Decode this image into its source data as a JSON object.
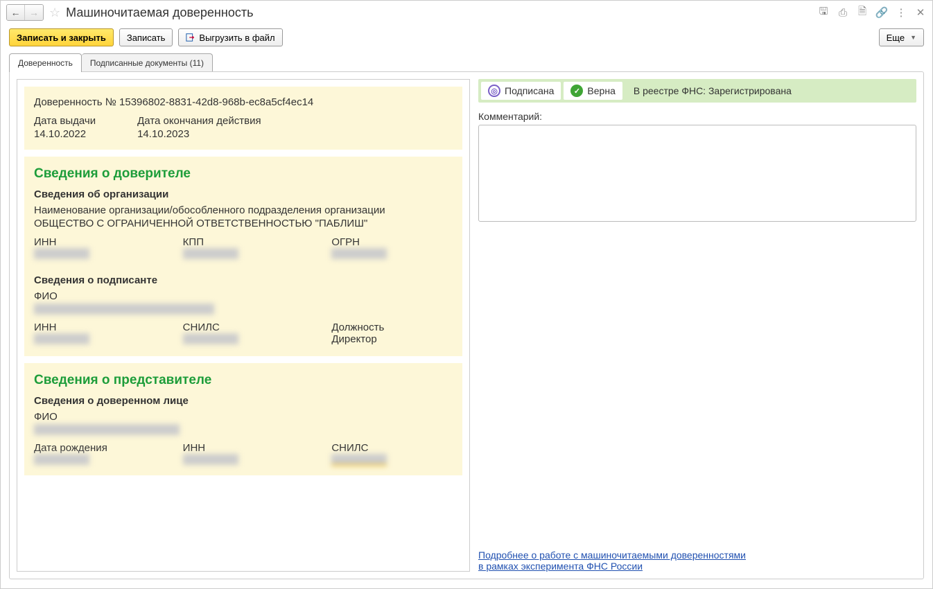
{
  "window": {
    "title": "Машиночитаемая доверенность"
  },
  "toolbar": {
    "save_close": "Записать и закрыть",
    "save": "Записать",
    "export": "Выгрузить в файл",
    "more": "Еще"
  },
  "tabs": {
    "main": "Доверенность",
    "signed": "Подписанные документы (11)"
  },
  "document": {
    "number_line": "Доверенность № 15396802-8831-42d8-968b-ec8a5cf4ec14",
    "issue_date_label": "Дата выдачи",
    "issue_date": "14.10.2022",
    "end_date_label": "Дата окончания действия",
    "end_date": "14.10.2023"
  },
  "principal": {
    "title": "Сведения о доверителе",
    "org_sub": "Сведения об организации",
    "org_name_label": "Наименование организации/обособленного подразделения организации",
    "org_name": "ОБЩЕСТВО С ОГРАНИЧЕННОЙ ОТВЕТСТВЕННОСТЬЮ \"ПАБЛИШ\"",
    "inn_label": "ИНН",
    "kpp_label": "КПП",
    "ogrn_label": "ОГРН",
    "signer_sub": "Сведения о подписанте",
    "fio_label": "ФИО",
    "snils_label": "СНИЛС",
    "position_label": "Должность",
    "position": "Директор"
  },
  "rep": {
    "title": "Сведения о представителе",
    "sub": "Сведения о доверенном лице",
    "fio_label": "ФИО",
    "dob_label": "Дата рождения",
    "inn_label": "ИНН",
    "snils_label": "СНИЛС"
  },
  "status": {
    "signed": "Подписана",
    "valid": "Верна",
    "registry": "В реестре ФНС: Зарегистрирована"
  },
  "comment": {
    "label": "Комментарий:"
  },
  "link": {
    "line1": "Подробнее о работе с машиночитаемыми доверенностями",
    "line2": "в рамках эксперимента ФНС России"
  }
}
